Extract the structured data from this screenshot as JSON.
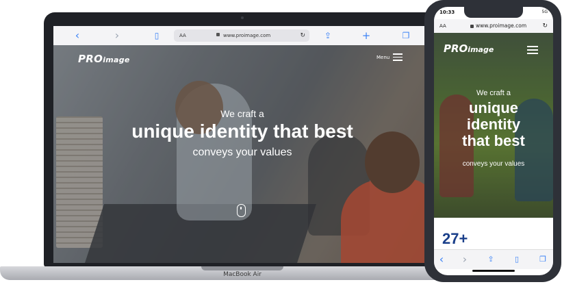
{
  "laptop": {
    "model_label": "MacBook Air",
    "browser": {
      "aa_label": "AA",
      "url": "www.proimage.com",
      "icons": [
        "back-icon",
        "forward-icon",
        "book-icon",
        "share-icon",
        "plus-icon",
        "tabs-icon",
        "reload-icon",
        "lock-icon"
      ],
      "back_glyph": "‹",
      "forward_glyph": "›",
      "book_glyph": "▯",
      "share_glyph": "⇪",
      "plus_glyph": "+",
      "tabs_glyph": "❐",
      "reload_glyph": "↻"
    },
    "site": {
      "logo_big": "PRO",
      "logo_small": "image",
      "menu_label": "Menu",
      "hero_kicker": "We craft a",
      "hero_title": "unique identity that best",
      "hero_sub": "conveys your values"
    }
  },
  "phone": {
    "time": "10:33",
    "status": "5G",
    "aa_label": "AA",
    "url": "www.proimage.com",
    "reload_glyph": "↻",
    "site": {
      "logo_big": "PRO",
      "logo_small": "image",
      "hero_kicker": "We craft a",
      "hero_title_1": "unique",
      "hero_title_2": "identity",
      "hero_title_3": "that best",
      "hero_sub": "conveys your values",
      "stat_value": "27+"
    },
    "toolbar": {
      "back_glyph": "‹",
      "forward_glyph": "›",
      "share_glyph": "⇪",
      "book_glyph": "▯",
      "tabs_glyph": "❐"
    }
  },
  "colors": {
    "browser_accent": "#3b82f6",
    "stat_color": "#1a3f8a",
    "device_frame": "#1f2126"
  }
}
